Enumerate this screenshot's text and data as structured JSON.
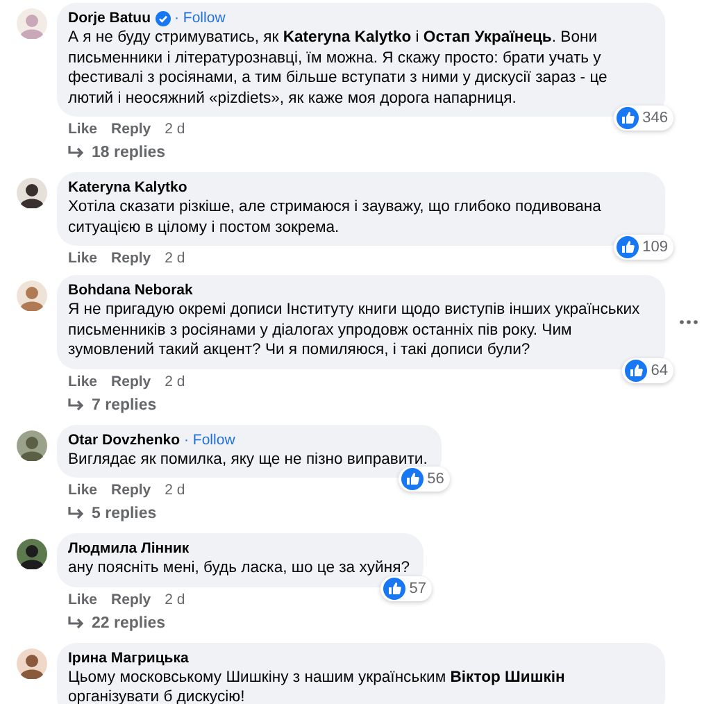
{
  "comments": [
    {
      "author": "Dorje Batuu",
      "verified": true,
      "follow": "· Follow",
      "text": "А я не буду стримуватись, як **Kateryna Kalytko** і **Остап Українець**. Вони письменники і літературознавці, їм можна. Я скажу просто: брати учать у фестивалі з росіянами, а тим більше вступати з ними у дискусії зараз - це лютий і неосяжний «pizdiets», як каже моя дорога напарниця.",
      "actions": [
        "Like",
        "Reply"
      ],
      "time": "2 d",
      "reactions": "346",
      "replies": "18 replies",
      "menu": false
    },
    {
      "author": "Kateryna Kalytko",
      "verified": false,
      "text": "Хотіла сказати різкіше, але стримаюся і зауважу, що глибоко подивована ситуацією в цілому і постом зокрема.",
      "actions": [
        "Like",
        "Reply"
      ],
      "time": "2 d",
      "reactions": "109",
      "menu": false
    },
    {
      "author": "Bohdana Neborak",
      "verified": false,
      "text": "Я не пригадую окремі дописи Інституту книги щодо виступів інших українських письменників з росіянами у діалогах упродовж останніх пів року. Чим зумовлений такий акцент? Чи я помиляюся, і такі дописи були?",
      "actions": [
        "Like",
        "Reply"
      ],
      "time": "2 d",
      "reactions": "64",
      "replies": "7 replies",
      "menu": true
    },
    {
      "author": "Otar Dovzhenko",
      "verified": false,
      "follow": "· Follow",
      "text": "Виглядає як помилка, яку ще не пізно виправити.",
      "actions": [
        "Like",
        "Reply"
      ],
      "time": "2 d",
      "reactions": "56",
      "replies": "5 replies",
      "menu": false
    },
    {
      "author": "Людмила Лінник",
      "verified": false,
      "text": "ану поясніть мені, будь ласка, шо це за хуйня?",
      "actions": [
        "Like",
        "Reply"
      ],
      "time": "2 d",
      "reactions": "57",
      "replies": "22 replies",
      "menu": false
    },
    {
      "author": "Ірина Магрицька",
      "verified": false,
      "text": "Цьому московському Шишкіну з нашим українським **Віктор Шишкін** організувати б дискусію!",
      "menu": false
    }
  ]
}
